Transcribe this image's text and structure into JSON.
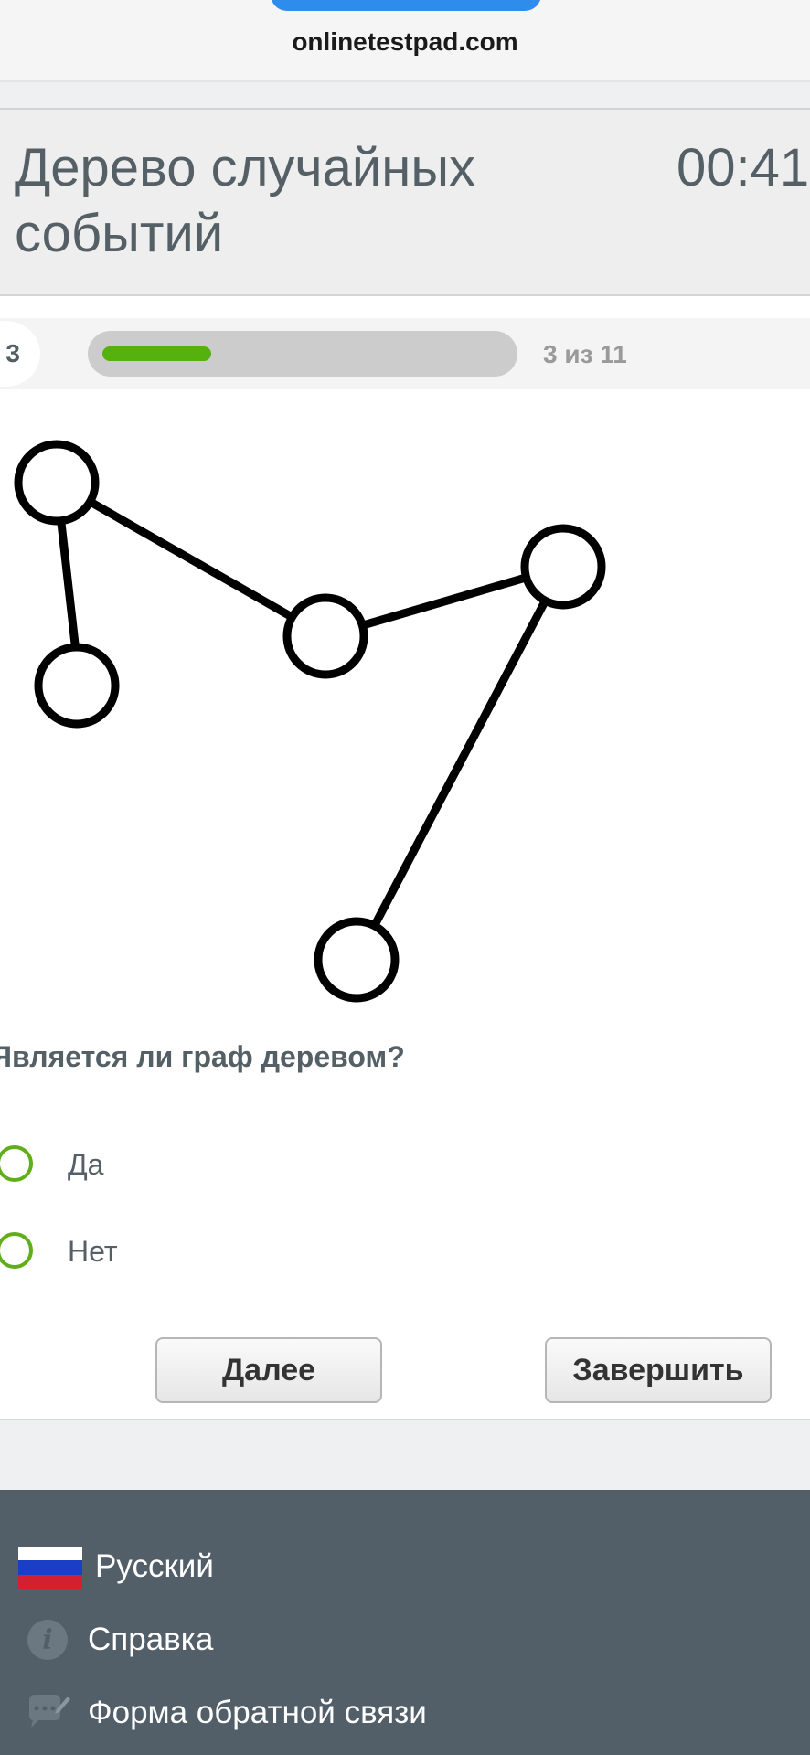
{
  "browser": {
    "url": "onlinetestpad.com"
  },
  "test": {
    "title": "Дерево случайных событий",
    "timer": "00:41"
  },
  "progress": {
    "question_number": "3",
    "current": 3,
    "total": 11,
    "label": "3 из 11",
    "bar_color": "#55b10e"
  },
  "question": {
    "text": "Является ли граф деревом?",
    "options": [
      {
        "label": "Да"
      },
      {
        "label": "Нет"
      }
    ]
  },
  "buttons": {
    "next": "Далее",
    "finish": "Завершить"
  },
  "footer": {
    "items": [
      {
        "label": "Русский",
        "icon": "russian-flag-icon"
      },
      {
        "label": "Справка",
        "icon": "info-icon"
      },
      {
        "label": "Форма обратной связи",
        "icon": "feedback-chat-icon"
      }
    ]
  },
  "colors": {
    "accent_green": "#5fae1a",
    "footer_bg": "#525f69",
    "title_text": "#555f66"
  }
}
